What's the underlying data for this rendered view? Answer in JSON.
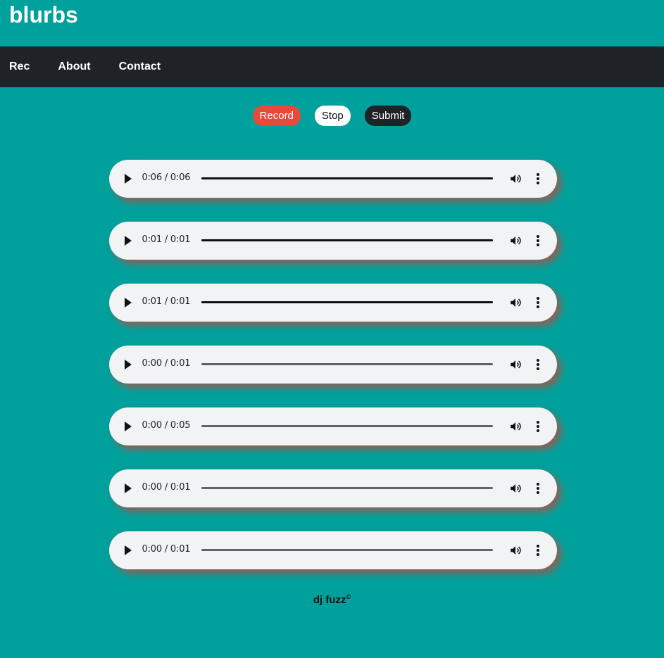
{
  "header": {
    "title": "blurbs"
  },
  "nav": {
    "items": [
      {
        "label": "Rec"
      },
      {
        "label": "About"
      },
      {
        "label": "Contact"
      }
    ]
  },
  "controls": {
    "record_label": "Record",
    "stop_label": "Stop",
    "submit_label": "Submit"
  },
  "players": [
    {
      "time": "0:06 / 0:06",
      "progress": 1.0
    },
    {
      "time": "0:01 / 0:01",
      "progress": 1.0
    },
    {
      "time": "0:01 / 0:01",
      "progress": 1.0
    },
    {
      "time": "0:00 / 0:01",
      "progress": 0.0
    },
    {
      "time": "0:00 / 0:05",
      "progress": 0.0
    },
    {
      "time": "0:00 / 0:01",
      "progress": 0.0
    },
    {
      "time": "0:00 / 0:01",
      "progress": 0.0
    }
  ],
  "footer": {
    "text": "dj fuzz",
    "mark": "©"
  },
  "colors": {
    "background": "#00a19c",
    "navbar": "#1f2226",
    "record": "#e9493a",
    "player": "#f1f3f4"
  },
  "icons": {
    "play": "play-icon",
    "volume": "volume-icon",
    "more": "more-vertical-icon"
  }
}
